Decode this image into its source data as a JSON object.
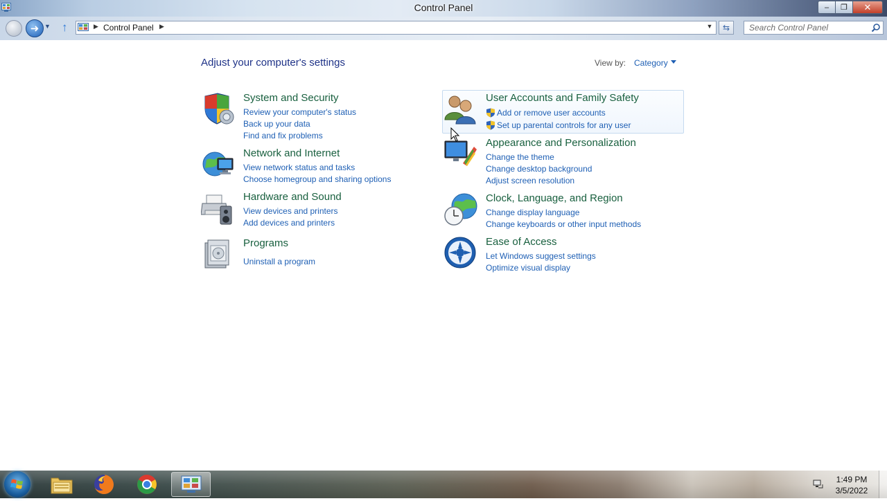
{
  "window": {
    "title": "Control Panel",
    "controls": {
      "minimize": "–",
      "maximize": "❐",
      "close": "✕"
    }
  },
  "navigation": {
    "breadcrumb": [
      "Control Panel"
    ],
    "search_placeholder": "Search Control Panel"
  },
  "main": {
    "title": "Adjust your computer's settings",
    "view_by_label": "View by:",
    "view_by_value": "Category",
    "categories": [
      {
        "title": "System and Security",
        "icon": "security-shield-icon",
        "links": [
          "Review your computer's status",
          "Back up your data",
          "Find and fix problems"
        ]
      },
      {
        "title": "Network and Internet",
        "icon": "network-globe-icon",
        "links": [
          "View network status and tasks",
          "Choose homegroup and sharing options"
        ]
      },
      {
        "title": "Hardware and Sound",
        "icon": "printer-speaker-icon",
        "links": [
          "View devices and printers",
          "Add devices and printers"
        ]
      },
      {
        "title": "Programs",
        "icon": "programs-icon",
        "links": [
          "Uninstall a program"
        ]
      },
      {
        "title": "User Accounts and Family Safety",
        "icon": "users-icon",
        "links": [
          "Add or remove user accounts",
          "Set up parental controls for any user"
        ]
      },
      {
        "title": "Appearance and Personalization",
        "icon": "monitor-paint-icon",
        "links": [
          "Change the theme",
          "Change desktop background",
          "Adjust screen resolution"
        ]
      },
      {
        "title": "Clock, Language, and Region",
        "icon": "clock-globe-icon",
        "links": [
          "Change display language",
          "Change keyboards or other input methods"
        ]
      },
      {
        "title": "Ease of Access",
        "icon": "ease-of-access-icon",
        "links": [
          "Let Windows suggest settings",
          "Optimize visual display"
        ]
      }
    ]
  },
  "taskbar": {
    "items": [
      "windows-start-icon",
      "file-explorer-icon",
      "firefox-icon",
      "chrome-icon",
      "control-panel-icon"
    ],
    "time": "1:49 PM",
    "date": "3/5/2022"
  },
  "colors": {
    "category_title": "#19603f",
    "link": "#1e5fb4",
    "page_title": "#1e3287",
    "highlight_border": "#c5daf0"
  }
}
